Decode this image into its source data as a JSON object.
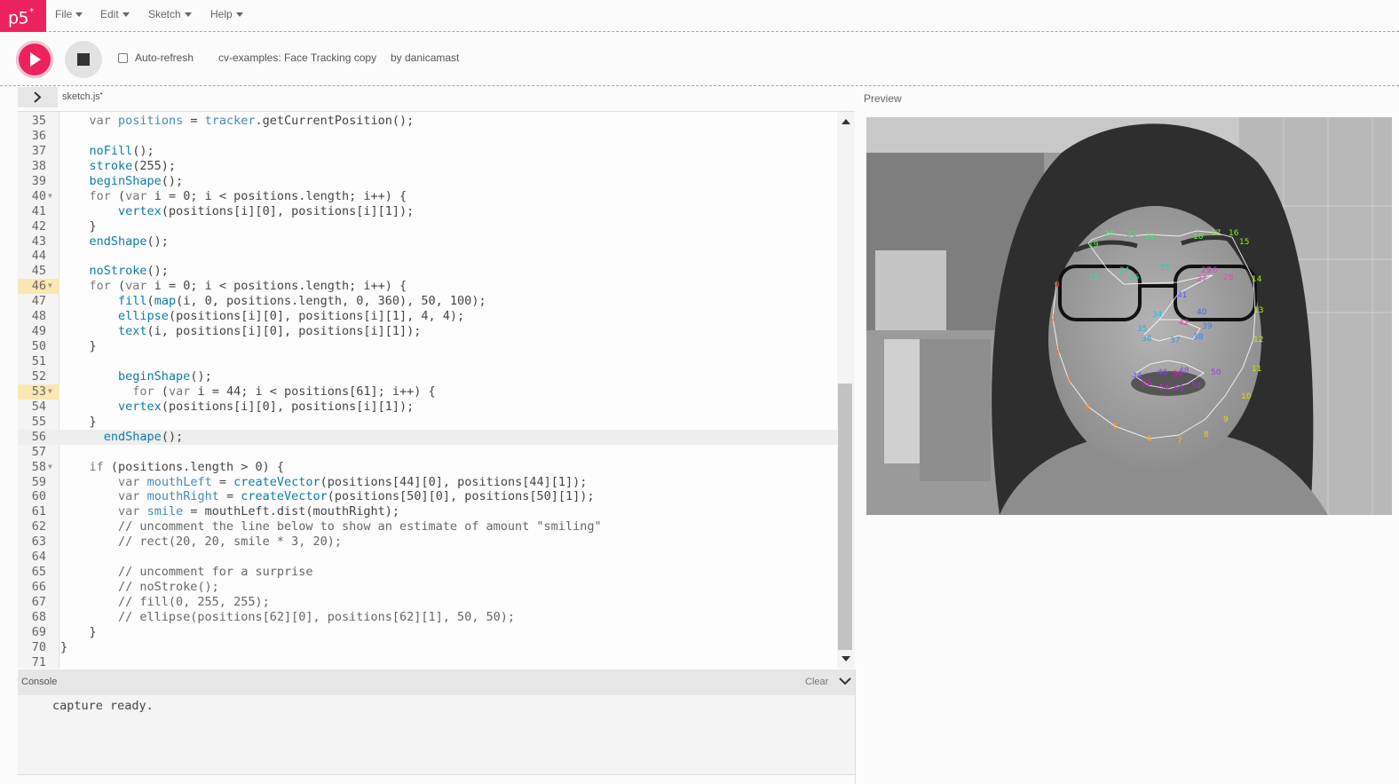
{
  "nav": {
    "logo": "p5",
    "logo_sup": "*",
    "menus": [
      "File",
      "Edit",
      "Sketch",
      "Help"
    ]
  },
  "toolbar": {
    "autorefresh_label": "Auto-refresh",
    "sketch_name": "cv-examples: Face Tracking copy",
    "sketch_author": "by danicamast"
  },
  "editor": {
    "file_tab": "sketch.js",
    "unsaved_marker": "•",
    "lines": [
      {
        "n": "35",
        "code": "    var positions = tracker.getCurrentPosition();"
      },
      {
        "n": "36",
        "code": ""
      },
      {
        "n": "37",
        "code": "    noFill();"
      },
      {
        "n": "38",
        "code": "    stroke(255);"
      },
      {
        "n": "39",
        "code": "    beginShape();"
      },
      {
        "n": "40",
        "code": "    for (var i = 0; i < positions.length; i++) {"
      },
      {
        "n": "41",
        "code": "        vertex(positions[i][0], positions[i][1]);"
      },
      {
        "n": "42",
        "code": "    }"
      },
      {
        "n": "43",
        "code": "    endShape();"
      },
      {
        "n": "44",
        "code": ""
      },
      {
        "n": "45",
        "code": "    noStroke();"
      },
      {
        "n": "46",
        "code": "    for (var i = 0; i < positions.length; i++) {"
      },
      {
        "n": "47",
        "code": "        fill(map(i, 0, positions.length, 0, 360), 50, 100);"
      },
      {
        "n": "48",
        "code": "        ellipse(positions[i][0], positions[i][1], 4, 4);"
      },
      {
        "n": "49",
        "code": "        text(i, positions[i][0], positions[i][1]);"
      },
      {
        "n": "50",
        "code": "    }"
      },
      {
        "n": "51",
        "code": ""
      },
      {
        "n": "52",
        "code": "        beginShape();"
      },
      {
        "n": "53",
        "code": "          for (var i = 44; i < positions[61]; i++) {"
      },
      {
        "n": "54",
        "code": "        vertex(positions[i][0], positions[i][1]);"
      },
      {
        "n": "55",
        "code": "    }"
      },
      {
        "n": "56",
        "code": "      endShape();"
      },
      {
        "n": "57",
        "code": ""
      },
      {
        "n": "58",
        "code": "    if (positions.length > 0) {"
      },
      {
        "n": "59",
        "code": "        var mouthLeft = createVector(positions[44][0], positions[44][1]);"
      },
      {
        "n": "60",
        "code": "        var mouthRight = createVector(positions[50][0], positions[50][1]);"
      },
      {
        "n": "61",
        "code": "        var smile = mouthLeft.dist(mouthRight);"
      },
      {
        "n": "62",
        "code": "        // uncomment the line below to show an estimate of amount \"smiling\""
      },
      {
        "n": "63",
        "code": "        // rect(20, 20, smile * 3, 20);"
      },
      {
        "n": "64",
        "code": ""
      },
      {
        "n": "65",
        "code": "        // uncomment for a surprise"
      },
      {
        "n": "66",
        "code": "        // noStroke();"
      },
      {
        "n": "67",
        "code": "        // fill(0, 255, 255);"
      },
      {
        "n": "68",
        "code": "        // ellipse(positions[62][0], positions[62][1], 50, 50);"
      },
      {
        "n": "69",
        "code": "    }"
      },
      {
        "n": "70",
        "code": "}"
      },
      {
        "n": "71",
        "code": ""
      }
    ]
  },
  "preview": {
    "label": "Preview"
  },
  "console": {
    "title": "Console",
    "clear_label": "Clear",
    "output": "capture ready."
  },
  "colors": {
    "accent": "#ed225d",
    "line_warning": "#fbe7b1"
  }
}
